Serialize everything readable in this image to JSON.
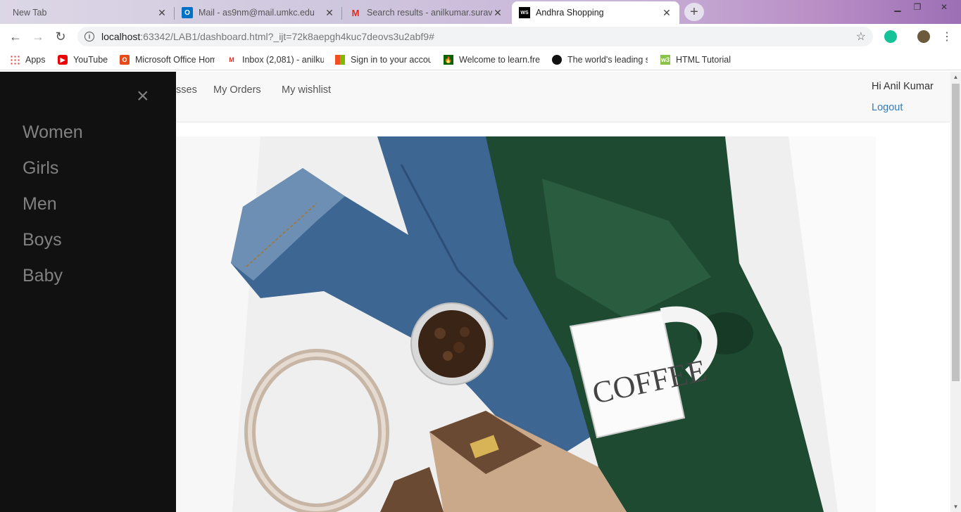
{
  "browser": {
    "tabs": [
      {
        "title": "New Tab",
        "favicon": "blank-icon"
      },
      {
        "title": "Mail - as9nm@mail.umkc.edu",
        "favicon": "outlook-icon"
      },
      {
        "title": "Search results - anilkumar.surava",
        "favicon": "gmail-icon"
      },
      {
        "title": "Andhra Shopping",
        "favicon": "ws-icon",
        "favicon_text": "WS",
        "active": true
      }
    ],
    "url_host": "localhost",
    "url_rest": ":63342/LAB1/dashboard.html?_ijt=72k8aepgh4kuc7deovs3u2abf9#",
    "bookmarks": [
      {
        "label": "Apps",
        "icon": "apps-grid-icon"
      },
      {
        "label": "YouTube",
        "icon": "youtube-icon"
      },
      {
        "label": "Microsoft Office Hom",
        "icon": "office-icon"
      },
      {
        "label": "Inbox (2,081) - anilku",
        "icon": "gmail-icon"
      },
      {
        "label": "Sign in to your accou",
        "icon": "microsoft-icon"
      },
      {
        "label": "Welcome to learn.fre",
        "icon": "freecodecamp-icon"
      },
      {
        "label": "The world's leading s",
        "icon": "github-icon"
      },
      {
        "label": "HTML Tutorial",
        "icon": "w3schools-icon"
      }
    ]
  },
  "page": {
    "nav_links": [
      "sses",
      "My Orders",
      "My wishlist"
    ],
    "greeting": "Hi Anil Kumar",
    "logout": "Logout",
    "hero_text": "COFFEE"
  },
  "sidenav": {
    "close_glyph": "×",
    "items": [
      "Women",
      "Girls",
      "Men",
      "Boys",
      "Baby"
    ]
  }
}
